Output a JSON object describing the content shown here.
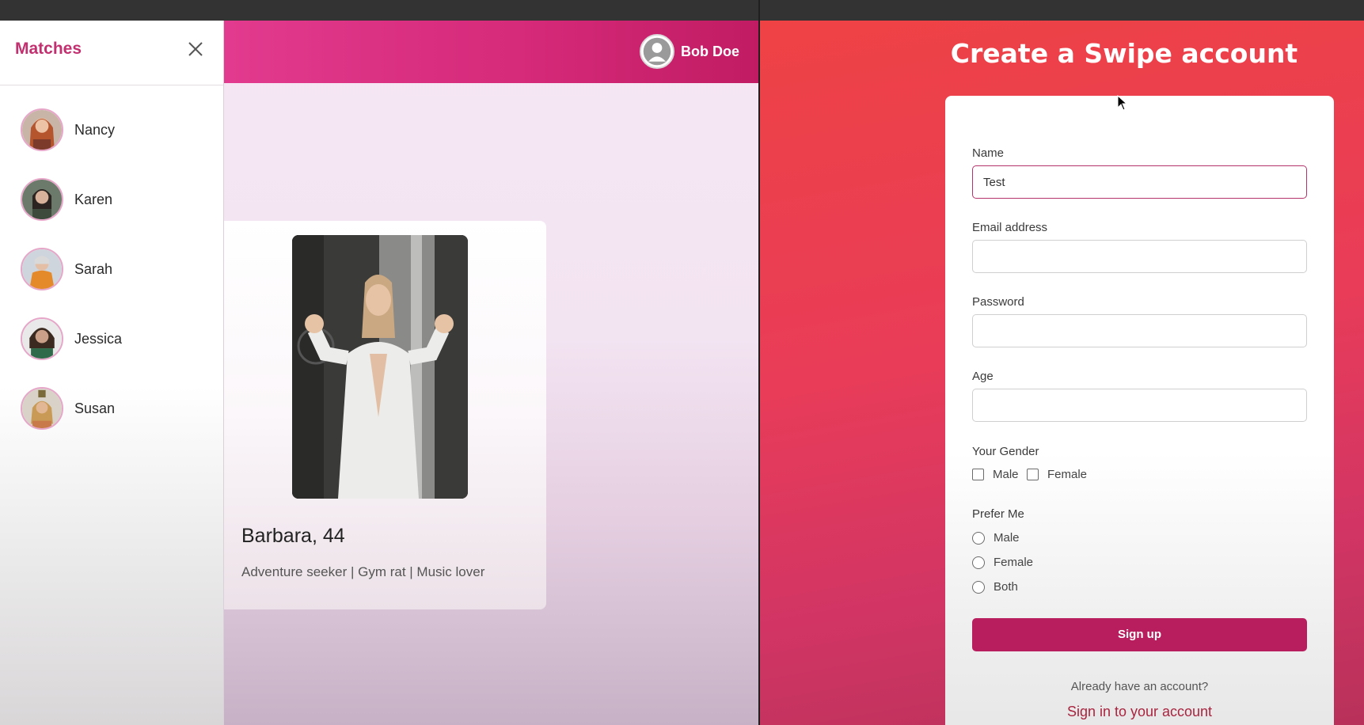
{
  "left_app": {
    "sidebar": {
      "title": "Matches",
      "close_icon": "close-icon",
      "matches": [
        {
          "name": "Nancy"
        },
        {
          "name": "Karen"
        },
        {
          "name": "Sarah"
        },
        {
          "name": "Jessica"
        },
        {
          "name": "Susan"
        }
      ]
    },
    "header": {
      "user_name": "Bob Doe",
      "user_icon": "user-avatar-icon",
      "colors": {
        "start": "#e23a8e",
        "end": "#c11c63"
      }
    },
    "profile_card": {
      "name_age": "Barbara, 44",
      "bio": "Adventure seeker | Gym rat | Music lover"
    }
  },
  "right_app": {
    "title": "Create a Swipe account",
    "form": {
      "name_label": "Name",
      "name_value": "Test",
      "email_label": "Email address",
      "email_value": "",
      "password_label": "Password",
      "password_value": "",
      "age_label": "Age",
      "age_value": "",
      "gender_label": "Your Gender",
      "gender_options": [
        "Male",
        "Female"
      ],
      "prefer_label": "Prefer Me",
      "prefer_options": [
        "Male",
        "Female",
        "Both"
      ],
      "signup_label": "Sign up",
      "already_text": "Already have an account?",
      "signin_link": "Sign in to your account"
    },
    "colors": {
      "accent": "#b81e5e",
      "link": "#a8243f",
      "bg_start": "#ee4245",
      "bg_end": "#b8315a"
    }
  }
}
